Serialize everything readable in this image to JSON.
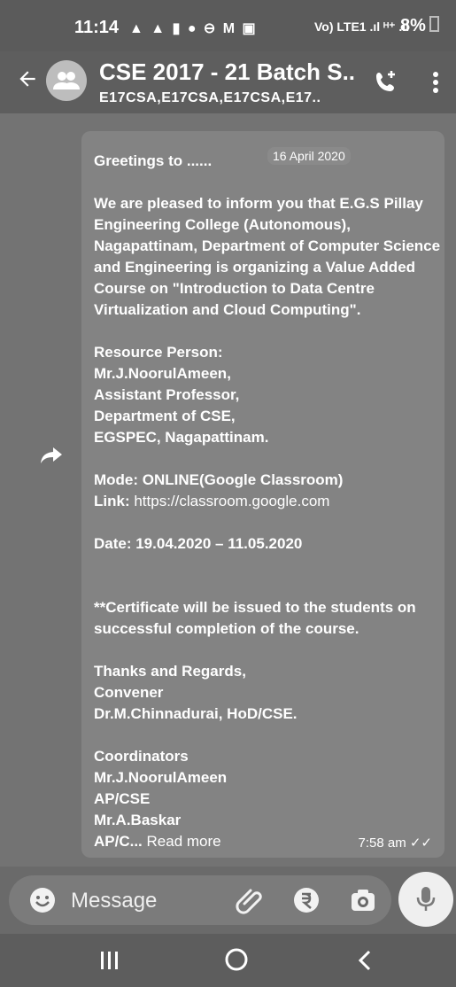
{
  "status_bar": {
    "time": "11:14",
    "icons": "▲ ▲ ▮ ● ⊖ M ▣",
    "network": "Vo) LTE1 .ıl ᴴ⁺ .ıl",
    "battery": "8%"
  },
  "header": {
    "title": "CSE 2017 - 21 Batch S..",
    "subtitle": "E17CSA,E17CSA,E17CSA,E17..",
    "icons": [
      "back-arrow-icon",
      "group-avatar-icon",
      "add-call-icon",
      "more-vert-icon"
    ]
  },
  "message": {
    "date_chip": "16 April 2020",
    "greeting": "Greetings to ......",
    "paragraph": "We are pleased to inform you that E.G.S Pillay Engineering College (Autonomous), Nagapattinam, Department of Computer Science and Engineering is organizing a Value Added Course on \"Introduction to Data Centre Virtualization and Cloud Computing\".",
    "resource_heading": "Resource Person:",
    "resource_lines": "Mr.J.NoorulAmeen,\nAssistant Professor,\nDepartment of CSE,\nEGSPEC, Nagapattinam.",
    "mode": "Mode: ONLINE(Google Classroom)",
    "link_label": "Link: ",
    "link": "https://classroom.google.com",
    "date": "Date: 19.04.2020 – 11.05.2020",
    "certificate": "**Certificate will be issued to the students on successful completion of the course.",
    "regards": "Thanks and Regards,\nConvener\nDr.M.Chinnadurai, HoD/CSE.",
    "coordinators": "Coordinators\nMr.J.NoorulAmeen\nAP/CSE\nMr.A.Baskar",
    "last_line": "AP/C...",
    "read_more": "Read more",
    "timestamp": "7:58 am ✓✓"
  },
  "composer": {
    "placeholder": "Message"
  },
  "colors": {
    "background": "#737373",
    "bubble": "#838383",
    "bar": "#5e5e5e"
  }
}
